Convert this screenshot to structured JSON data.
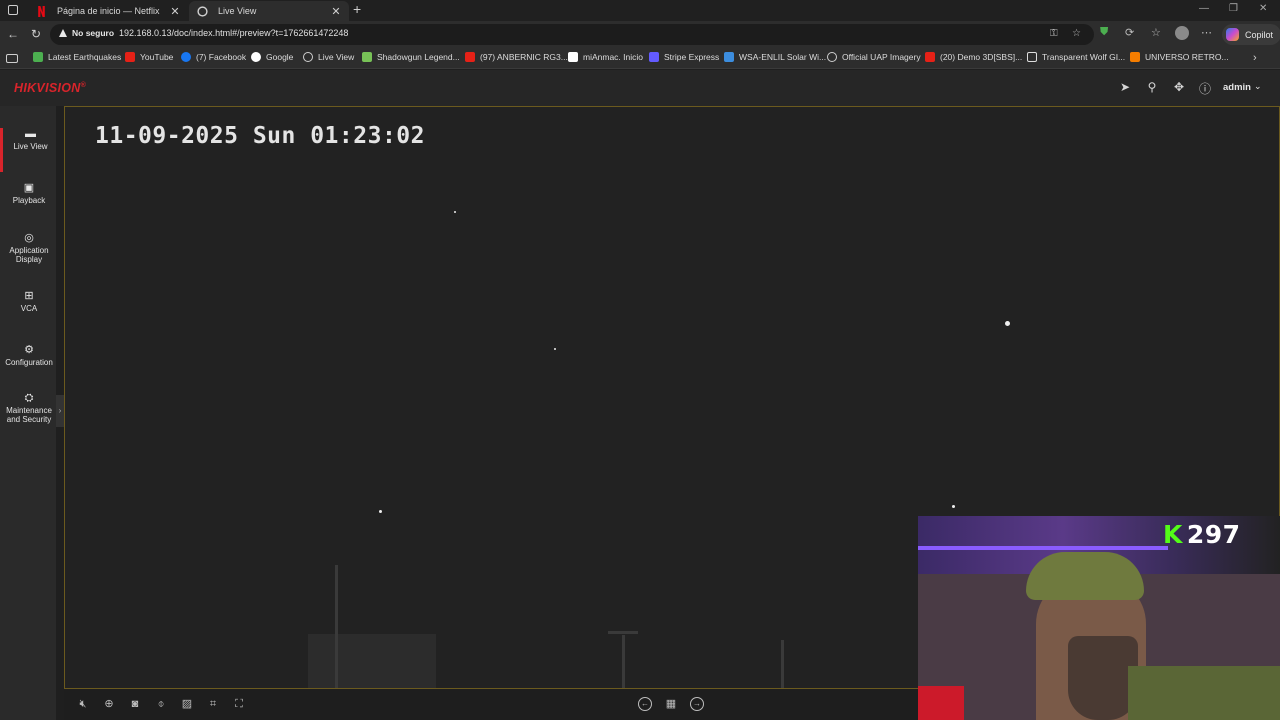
{
  "browser": {
    "tabs": [
      {
        "title": "Página de inicio — Netflix",
        "favicon": "netflix-icon",
        "color": "#e50914"
      },
      {
        "title": "Live View",
        "favicon": "globe-icon",
        "color": "#cfcfcf",
        "active": true
      }
    ],
    "security_label": "No seguro",
    "url": "192.168.0.13/doc/index.html#/preview?t=1762661472248",
    "copilot_label": "Copilot",
    "bookmarks": [
      {
        "label": "Latest Earthquakes",
        "icon": "earthquake-icon",
        "color": "#4caf50"
      },
      {
        "label": "YouTube",
        "icon": "youtube-icon",
        "color": "#e62117"
      },
      {
        "label": "(7) Facebook",
        "icon": "facebook-icon",
        "color": "#1877f2"
      },
      {
        "label": "Google",
        "icon": "google-icon",
        "color": "#ffffff"
      },
      {
        "label": "Live View",
        "icon": "globe-icon",
        "color": "#cfcfcf"
      },
      {
        "label": "Shadowgun Legend...",
        "icon": "android-icon",
        "color": "#78c257"
      },
      {
        "label": "(97) ANBERNIC RG3...",
        "icon": "youtube-icon",
        "color": "#e62117"
      },
      {
        "label": "miAnmac. Inicio",
        "icon": "r-icon",
        "color": "#ffffff"
      },
      {
        "label": "Stripe Express",
        "icon": "stripe-icon",
        "color": "#635bff"
      },
      {
        "label": "WSA-ENLIL Solar Wi...",
        "icon": "wsa-icon",
        "color": "#3c8dde"
      },
      {
        "label": "Official UAP Imagery",
        "icon": "globe-icon",
        "color": "#cfcfcf"
      },
      {
        "label": "(20) Demo 3D[SBS]...",
        "icon": "youtube-icon",
        "color": "#e62117"
      },
      {
        "label": "Transparent Wolf GI...",
        "icon": "page-icon",
        "color": "#dddddd"
      },
      {
        "label": "UNIVERSO RETRO...",
        "icon": "blogger-icon",
        "color": "#f57d00"
      }
    ]
  },
  "app": {
    "brand": "HIKVISION",
    "brand_mark": "®",
    "brand_color": "#d8242b",
    "user": "admin",
    "sidebar": [
      {
        "label": "Live View",
        "icon": "live-view-icon",
        "active": true
      },
      {
        "label": "Playback",
        "icon": "playback-icon"
      },
      {
        "label": "Application Display",
        "icon": "ai-icon"
      },
      {
        "label": "VCA",
        "icon": "vca-icon"
      },
      {
        "label": "Configuration",
        "icon": "gear-icon"
      },
      {
        "label": "Maintenance and Security",
        "icon": "maintenance-icon"
      }
    ],
    "osd_timestamp": "11-09-2025 Sun 01:23:02"
  },
  "overlay": {
    "kick_count": "297",
    "kick_color": "#53fc18"
  }
}
